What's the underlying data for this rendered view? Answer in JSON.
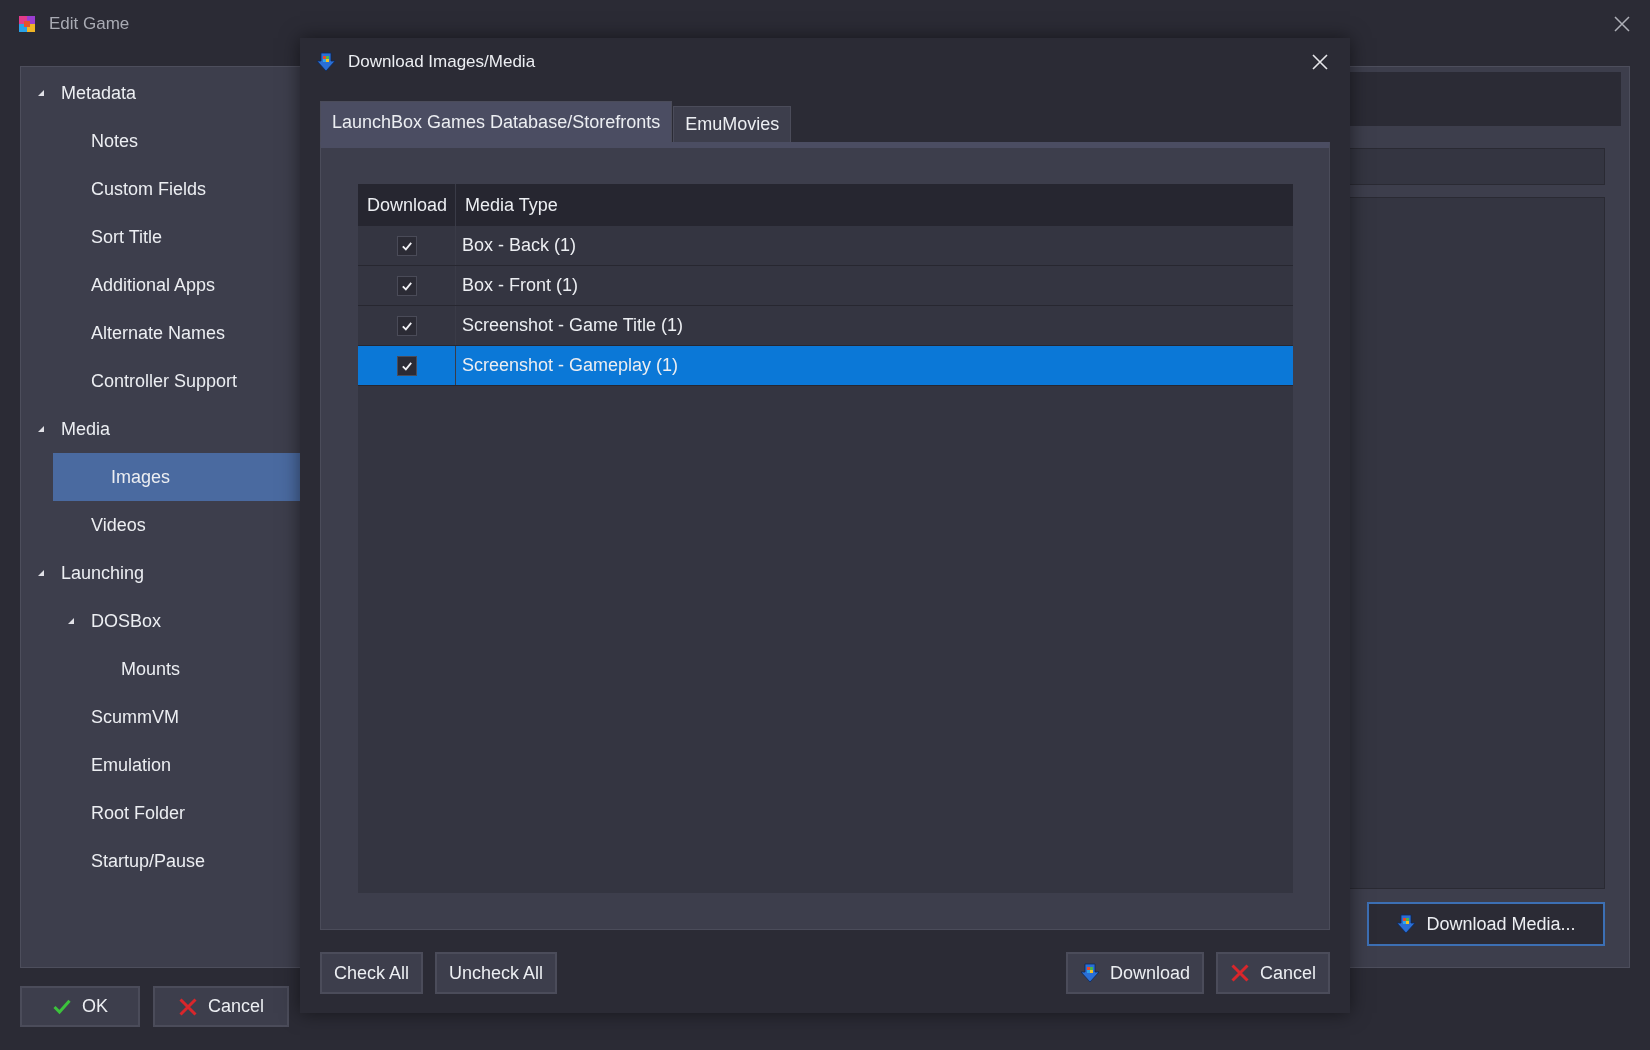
{
  "window": {
    "title": "Edit Game"
  },
  "sidebar": {
    "items": [
      {
        "label": "Metadata",
        "selected": false,
        "expanded": true,
        "children": [
          {
            "label": "Notes",
            "selected": false
          },
          {
            "label": "Custom Fields",
            "selected": false
          },
          {
            "label": "Sort Title",
            "selected": false
          },
          {
            "label": "Additional Apps",
            "selected": false
          },
          {
            "label": "Alternate Names",
            "selected": false
          },
          {
            "label": "Controller Support",
            "selected": false
          }
        ]
      },
      {
        "label": "Media",
        "selected": false,
        "expanded": true,
        "children": [
          {
            "label": "Images",
            "selected": true
          },
          {
            "label": "Videos",
            "selected": false
          }
        ]
      },
      {
        "label": "Launching",
        "selected": false,
        "expanded": true,
        "children": [
          {
            "label": "DOSBox",
            "selected": false,
            "expanded": true,
            "children": [
              {
                "label": "Mounts",
                "selected": false
              }
            ]
          },
          {
            "label": "ScummVM",
            "selected": false
          },
          {
            "label": "Emulation",
            "selected": false
          },
          {
            "label": "Root Folder",
            "selected": false
          },
          {
            "label": "Startup/Pause",
            "selected": false
          }
        ]
      }
    ]
  },
  "footer_buttons": [
    {
      "label": "OK",
      "kind": "ok"
    },
    {
      "label": "Cancel",
      "kind": "cancel"
    }
  ],
  "right_panel": {
    "button": "Download Media..."
  },
  "dialog": {
    "title": "Download Images/Media",
    "tabs": [
      {
        "label": "LaunchBox Games Database/Storefronts",
        "selected": true
      },
      {
        "label": "EmuMovies",
        "selected": false
      }
    ],
    "table": {
      "columns": [
        "Download",
        "Media Type"
      ],
      "rows": [
        {
          "media_type": "Box - Back (1)",
          "checked": true,
          "selected": false
        },
        {
          "media_type": "Box - Front (1)",
          "checked": true,
          "selected": false
        },
        {
          "media_type": "Screenshot - Game Title (1)",
          "checked": true,
          "selected": false
        },
        {
          "media_type": "Screenshot - Gameplay (1)",
          "checked": true,
          "selected": true
        }
      ]
    },
    "left_buttons": [
      "Check All",
      "Uncheck All"
    ],
    "right_buttons": [
      {
        "label": "Download",
        "kind": "download"
      },
      {
        "label": "Cancel",
        "kind": "cancel"
      }
    ]
  }
}
